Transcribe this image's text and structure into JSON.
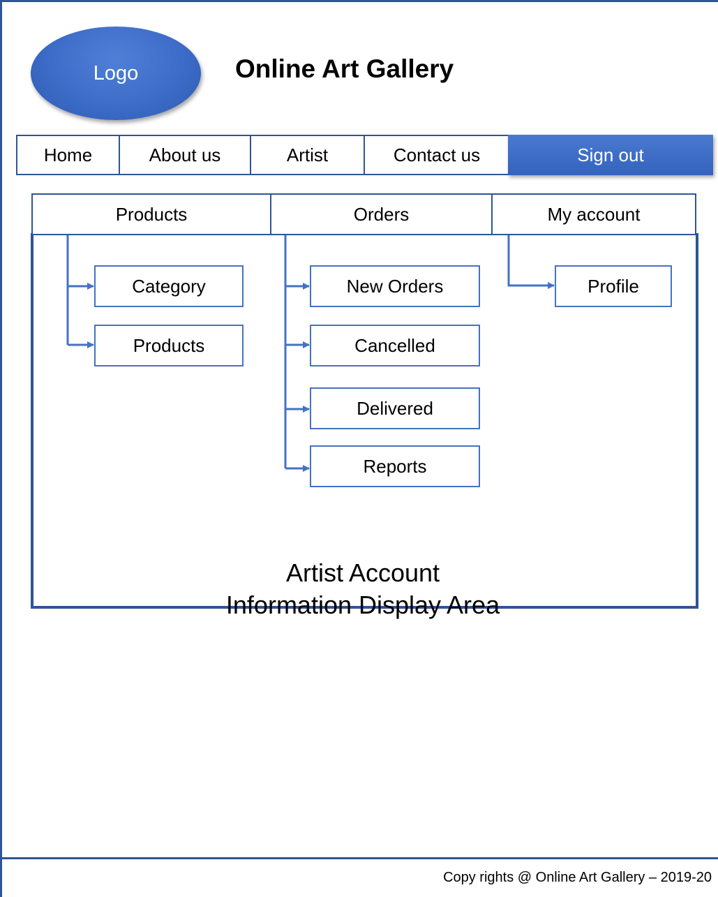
{
  "header": {
    "logo_label": "Logo",
    "title": "Online Art Gallery"
  },
  "nav": {
    "items": [
      "Home",
      "About us",
      "Artist",
      "Contact us"
    ],
    "sign_out": "Sign out"
  },
  "tabs": [
    {
      "label": "Products",
      "subitems": [
        "Category",
        "Products"
      ]
    },
    {
      "label": "Orders",
      "subitems": [
        "New Orders",
        "Cancelled",
        "Delivered",
        "Reports"
      ]
    },
    {
      "label": "My account",
      "subitems": [
        "Profile"
      ]
    }
  ],
  "display_area": {
    "line1": "Artist Account",
    "line2": "Information Display Area"
  },
  "footer": {
    "copyright": "Copy rights @ Online Art Gallery – 2019-20"
  },
  "colors": {
    "frame": "#2f5597",
    "accent": "#4472c4",
    "button": "#3c6cc8"
  }
}
